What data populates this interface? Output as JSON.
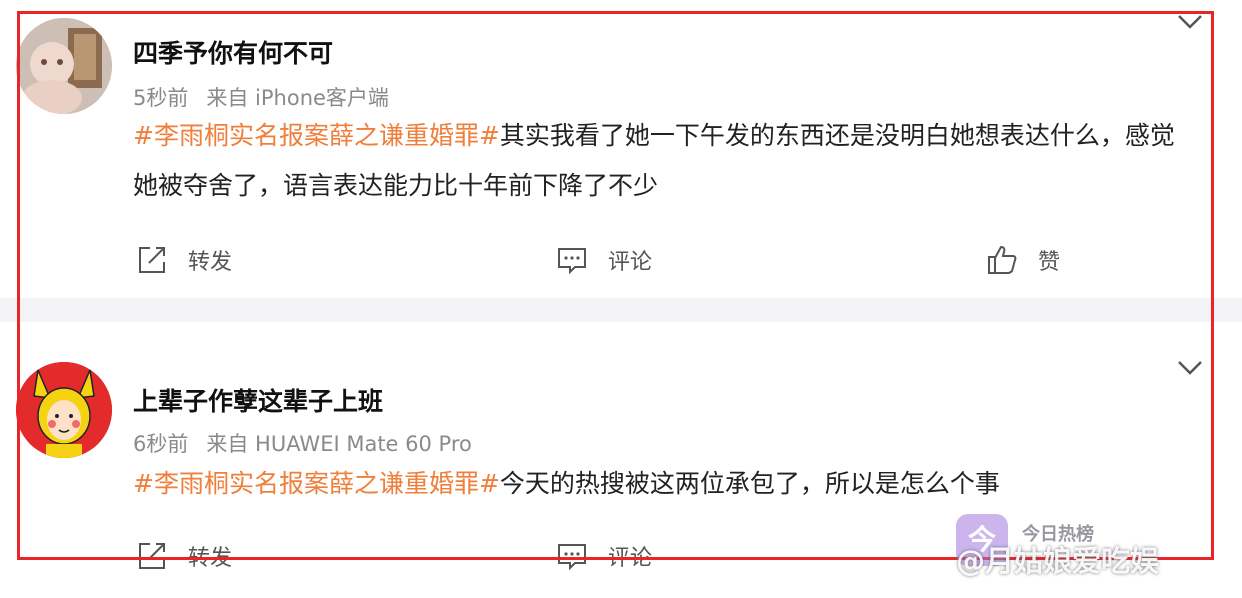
{
  "posts": [
    {
      "username": "四季予你有何不可",
      "time": "5秒前",
      "source": "来自 iPhone客户端",
      "hashtag": "#李雨桐实名报案薛之谦重婚罪#",
      "text": "其实我看了她一下午发的东西还是没明白她想表达什么，感觉她被夺舍了，语言表达能力比十年前下降了不少",
      "actions": {
        "repost": "转发",
        "comment": "评论",
        "like": "赞"
      }
    },
    {
      "username": "上辈子作孽这辈子上班",
      "time": "6秒前",
      "source": "来自 HUAWEI Mate 60 Pro",
      "hashtag": "#李雨桐实名报案薛之谦重婚罪#",
      "text": "今天的热搜被这两位承包了，所以是怎么个事",
      "actions": {
        "repost": "转发",
        "comment": "评论"
      }
    }
  ],
  "watermark": {
    "brand": "今日热榜",
    "author": "@月姑娘爱吃娱"
  },
  "colors": {
    "hashtag": "#ef7f3a",
    "highlight_border": "#e8262a",
    "meta": "#8a8a8a"
  },
  "icons": [
    "chevron-down-icon",
    "repost-icon",
    "comment-icon",
    "like-icon"
  ]
}
